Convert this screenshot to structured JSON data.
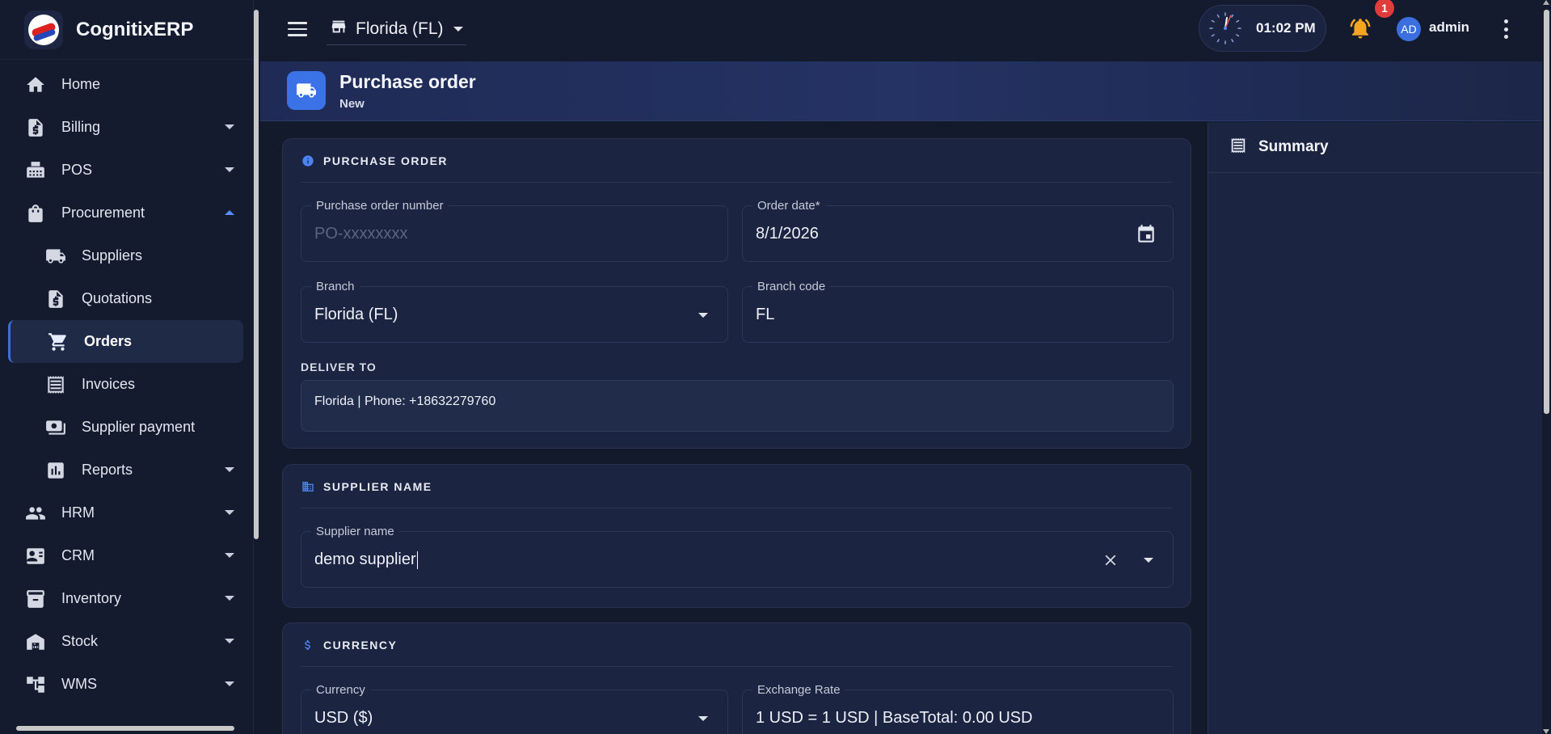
{
  "app": {
    "name": "CognitixERP"
  },
  "colors": {
    "accent": "#3b6fe0",
    "badge": "#e23b3b",
    "bell": "#f5a524",
    "background": "#131a2c",
    "card": "#1b2440"
  },
  "sidebar": {
    "items": [
      {
        "label": "Home",
        "icon": "home-icon"
      },
      {
        "label": "Billing",
        "icon": "billing-icon"
      },
      {
        "label": "POS",
        "icon": "pos-icon"
      },
      {
        "label": "Procurement",
        "icon": "bag-icon"
      },
      {
        "label": "Suppliers",
        "icon": "truck-icon"
      },
      {
        "label": "Quotations",
        "icon": "document-dollar-icon"
      },
      {
        "label": "Orders",
        "icon": "cart-icon"
      },
      {
        "label": "Invoices",
        "icon": "receipt-icon"
      },
      {
        "label": "Supplier payment",
        "icon": "payment-icon"
      },
      {
        "label": "Reports",
        "icon": "bar-chart-icon"
      },
      {
        "label": "HRM",
        "icon": "people-icon"
      },
      {
        "label": "CRM",
        "icon": "contact-card-icon"
      },
      {
        "label": "Inventory",
        "icon": "archive-icon"
      },
      {
        "label": "Stock",
        "icon": "warehouse-icon"
      },
      {
        "label": "WMS",
        "icon": "hierarchy-icon"
      }
    ],
    "active": "Orders"
  },
  "topbar": {
    "branch": "Florida (FL)",
    "time": "01:02 PM",
    "notification_count": "1",
    "avatar_initials": "AD",
    "username": "admin"
  },
  "page": {
    "title": "Purchase order",
    "subtitle": "New"
  },
  "purchase_order": {
    "section_title": "PURCHASE ORDER",
    "po_number_label": "Purchase order number",
    "po_number_placeholder": "PO-xxxxxxxx",
    "order_date_label": "Order date*",
    "order_date_value": "8/1/2026",
    "branch_label": "Branch",
    "branch_value": "Florida (FL)",
    "branch_code_label": "Branch code",
    "branch_code_value": "FL",
    "deliver_to_label": "DELIVER TO",
    "deliver_to_value": "Florida | Phone: +18632279760"
  },
  "supplier": {
    "section_title": "SUPPLIER NAME",
    "label": "Supplier name",
    "value": "demo supplier"
  },
  "currency": {
    "section_title": "CURRENCY",
    "currency_label": "Currency",
    "currency_value": "USD ($)",
    "exchange_label": "Exchange Rate",
    "exchange_value": "1 USD = 1 USD | BaseTotal: 0.00 USD"
  },
  "summary": {
    "title": "Summary"
  }
}
